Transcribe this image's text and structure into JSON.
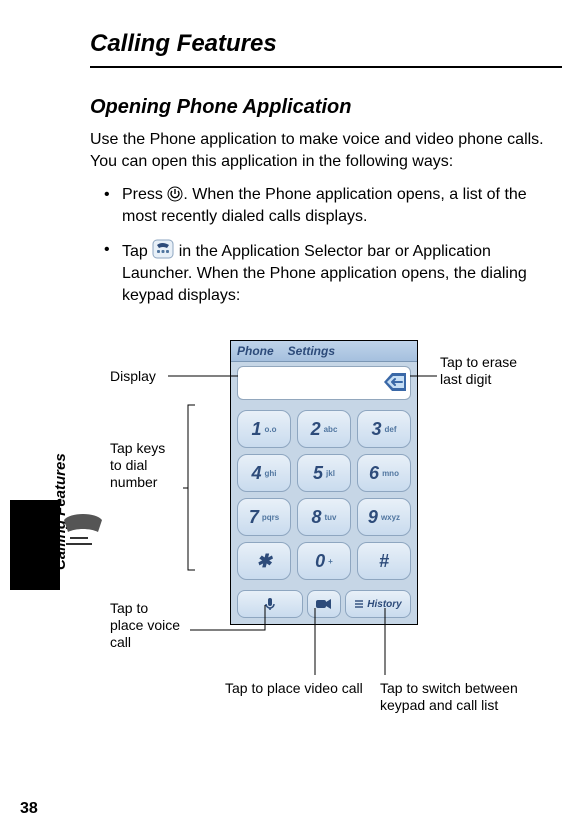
{
  "chapter_title": "Calling Features",
  "section_title": "Opening Phone Application",
  "intro_text": "Use the Phone application to make voice and video phone calls. You can open this application in the following ways:",
  "bullets": {
    "b1_a": "Press ",
    "b1_b": ". When the Phone application opens, a list of the most recently dialed calls displays.",
    "b2_a": "Tap ",
    "b2_b": " in the Application Selector bar or Application Launcher. When the Phone application opens, the dialing keypad displays:"
  },
  "side_text": "Calling Features",
  "page_number": "38",
  "phone": {
    "menu": {
      "item1": "Phone",
      "item2": "Settings"
    },
    "keys": [
      {
        "d": "1",
        "l": "o.o"
      },
      {
        "d": "2",
        "l": "abc"
      },
      {
        "d": "3",
        "l": "def"
      },
      {
        "d": "4",
        "l": "ghi"
      },
      {
        "d": "5",
        "l": "jkl"
      },
      {
        "d": "6",
        "l": "mno"
      },
      {
        "d": "7",
        "l": "pqrs"
      },
      {
        "d": "8",
        "l": "tuv"
      },
      {
        "d": "9",
        "l": "wxyz"
      },
      {
        "d": "✱",
        "l": ""
      },
      {
        "d": "0",
        "l": "+"
      },
      {
        "d": "#",
        "l": ""
      }
    ],
    "history_label": "History"
  },
  "callouts": {
    "display": "Display",
    "erase": "Tap to erase last digit",
    "keys": "Tap keys to dial number",
    "voice": "Tap to place voice call",
    "video": "Tap to place video call",
    "history": "Tap to switch between keypad and call list"
  }
}
